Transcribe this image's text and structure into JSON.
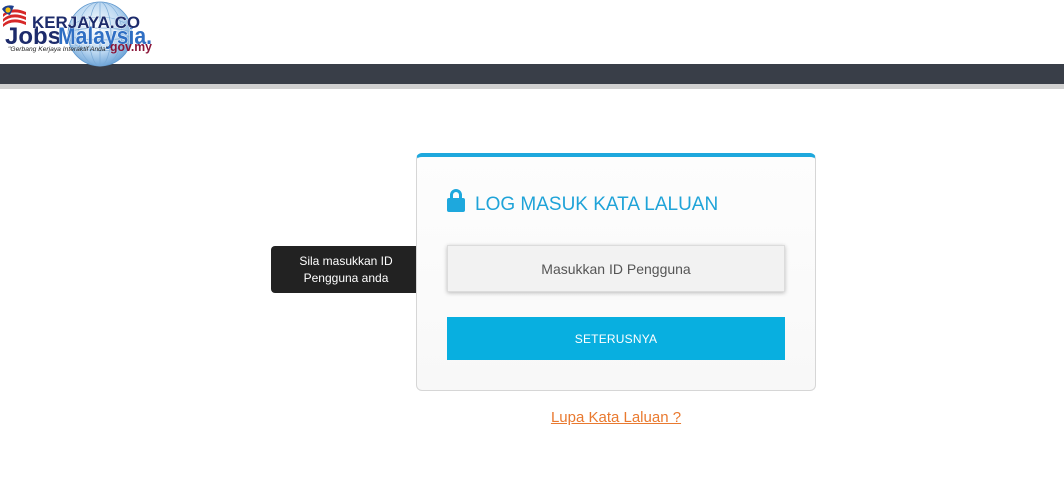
{
  "logo": {
    "brand_kerjaya": "KERJAYA.CO",
    "brand_jobs": "Jobs",
    "brand_malaysia": "Malaysia.",
    "domain": "gov.my",
    "tagline": "\"Gerbang Kerjaya Interaktif Anda\""
  },
  "login": {
    "icon": "lock-icon",
    "title": "LOG MASUK KATA LALUAN",
    "user_id_placeholder": "Masukkan ID Pengguna",
    "submit_label": "SETERUSNYA",
    "forgot_password_link": "Lupa Kata Laluan ?"
  },
  "help": {
    "icon": "help-icon",
    "glyph": "?",
    "tooltip": "Sila masukkan ID Pengguna anda"
  },
  "colors": {
    "header_bar": "#393e48",
    "accent": "#1ea8dd",
    "button": "#08afe0",
    "link": "#e9792f",
    "tooltip_bg": "#222222"
  }
}
